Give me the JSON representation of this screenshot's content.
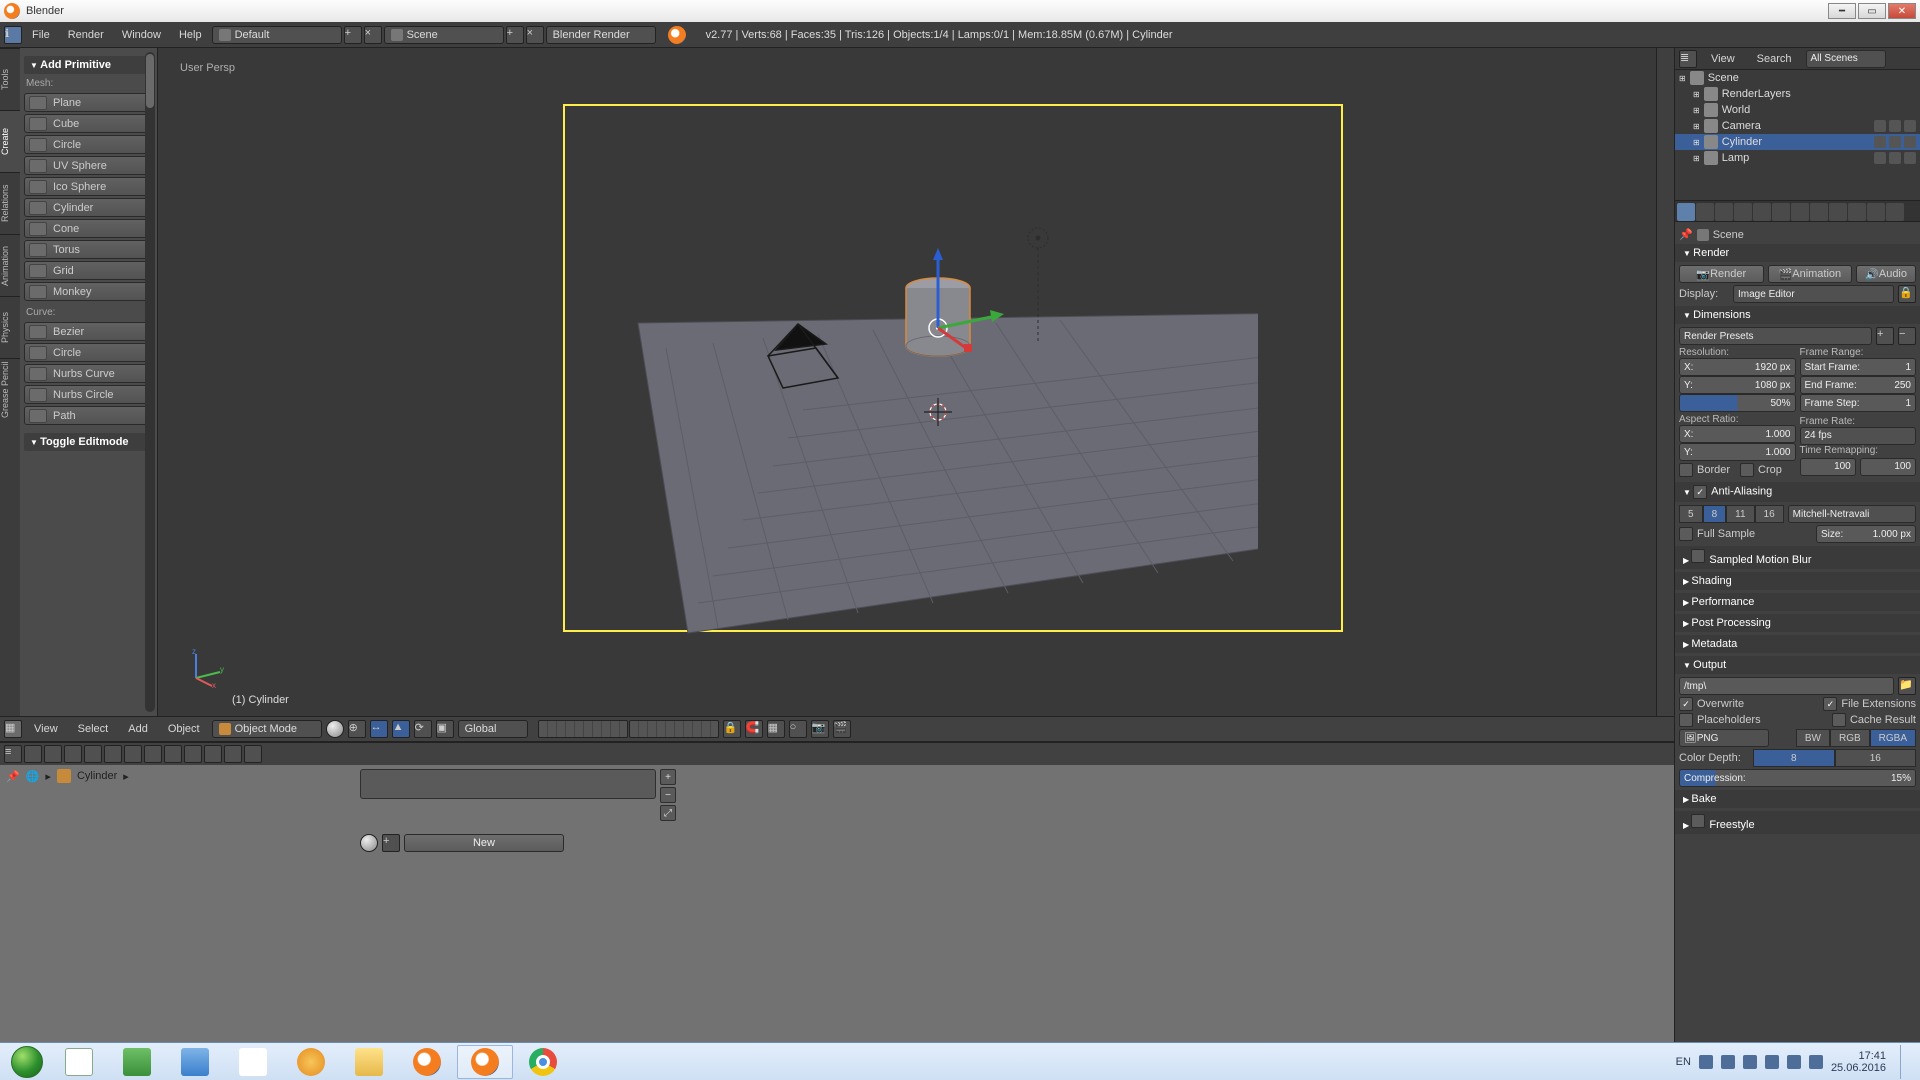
{
  "titlebar": {
    "title": "Blender"
  },
  "menus": [
    "File",
    "Render",
    "Window",
    "Help"
  ],
  "layout_sel": "Default",
  "scene_sel": "Scene",
  "engine_sel": "Blender Render",
  "stats": "v2.77 | Verts:68 | Faces:35 | Tris:126 | Objects:1/4 | Lamps:0/1 | Mem:18.85M (0.67M) | Cylinder",
  "toolshelf": {
    "tabs": [
      "Tools",
      "Create",
      "Relations",
      "Animation",
      "Physics",
      "Grease Pencil"
    ],
    "add_primitive": "Add Primitive",
    "mesh_lbl": "Mesh:",
    "mesh": [
      "Plane",
      "Cube",
      "Circle",
      "UV Sphere",
      "Ico Sphere",
      "Cylinder",
      "Cone",
      "Torus",
      "Grid",
      "Monkey"
    ],
    "curve_lbl": "Curve:",
    "curve": [
      "Bezier",
      "Circle",
      "Nurbs Curve",
      "Nurbs Circle",
      "Path"
    ],
    "toggle_edit": "Toggle Editmode"
  },
  "viewport": {
    "persp": "User Persp",
    "obj_name": "(1) Cylinder"
  },
  "vp_header": {
    "menus": [
      "View",
      "Select",
      "Add",
      "Object"
    ],
    "mode": "Object Mode",
    "orientation": "Global"
  },
  "dopesheet": {
    "breadcrumb": "Cylinder",
    "new": "New"
  },
  "outliner": {
    "hdr": [
      "View",
      "Search"
    ],
    "filter": "All Scenes",
    "rows": [
      {
        "ind": 0,
        "label": "Scene"
      },
      {
        "ind": 1,
        "label": "RenderLayers"
      },
      {
        "ind": 1,
        "label": "World"
      },
      {
        "ind": 1,
        "label": "Camera",
        "eyes": true
      },
      {
        "ind": 1,
        "label": "Cylinder",
        "eyes": true,
        "sel": true
      },
      {
        "ind": 1,
        "label": "Lamp",
        "eyes": true
      }
    ]
  },
  "props": {
    "scene_crumb": "Scene",
    "render_sec": "Render",
    "render_btns": [
      "Render",
      "Animation",
      "Audio"
    ],
    "display_lbl": "Display:",
    "display_val": "Image Editor",
    "dim_sec": "Dimensions",
    "render_presets": "Render Presets",
    "res_lbl": "Resolution:",
    "res_x": {
      "l": "X:",
      "v": "1920 px"
    },
    "res_y": {
      "l": "Y:",
      "v": "1080 px"
    },
    "res_pct": "50%",
    "frange_lbl": "Frame Range:",
    "fr_start": {
      "l": "Start Frame:",
      "v": "1"
    },
    "fr_end": {
      "l": "End Frame:",
      "v": "250"
    },
    "fr_step": {
      "l": "Frame Step:",
      "v": "1"
    },
    "aspect_lbl": "Aspect Ratio:",
    "asp_x": {
      "l": "X:",
      "v": "1.000"
    },
    "asp_y": {
      "l": "Y:",
      "v": "1.000"
    },
    "frate_lbl": "Frame Rate:",
    "frate_val": "24 fps",
    "tremap_lbl": "Time Remapping:",
    "tremap_a": "100",
    "tremap_b": "100",
    "border": "Border",
    "crop": "Crop",
    "aa_sec": "Anti-Aliasing",
    "aa_samples": [
      "5",
      "8",
      "11",
      "16"
    ],
    "aa_filter": "Mitchell-Netravali",
    "full_sample": "Full Sample",
    "aa_size": {
      "l": "Size:",
      "v": "1.000 px"
    },
    "smb_sec": "Sampled Motion Blur",
    "shading_sec": "Shading",
    "perf_sec": "Performance",
    "post_sec": "Post Processing",
    "meta_sec": "Metadata",
    "out_sec": "Output",
    "out_path": "/tmp\\",
    "overwrite": "Overwrite",
    "fileext": "File Extensions",
    "placeholders": "Placeholders",
    "cache": "Cache Result",
    "format": "PNG",
    "bw": "BW",
    "rgb": "RGB",
    "rgba": "RGBA",
    "cdepth_lbl": "Color Depth:",
    "cdepth": [
      "8",
      "16"
    ],
    "compress": {
      "l": "Compression:",
      "v": "15%"
    },
    "bake_sec": "Bake",
    "freestyle_sec": "Freestyle"
  },
  "taskbar": {
    "lang": "EN",
    "time": "17:41",
    "date": "25.06.2016"
  }
}
